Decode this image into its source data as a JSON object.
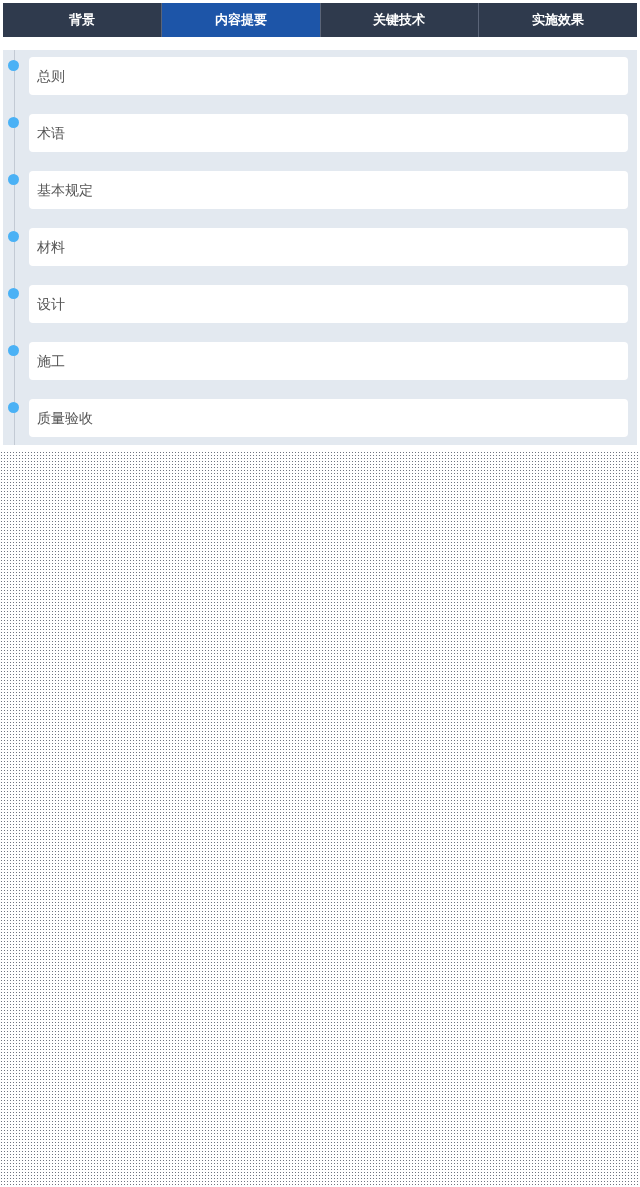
{
  "tabs": [
    {
      "label": "背景",
      "selected": false
    },
    {
      "label": "内容提要",
      "selected": true
    },
    {
      "label": "关键技术",
      "selected": false
    },
    {
      "label": "实施效果",
      "selected": false
    }
  ],
  "timeline": {
    "items": [
      {
        "label": "总则"
      },
      {
        "label": "术语"
      },
      {
        "label": "基本规定"
      },
      {
        "label": "材料"
      },
      {
        "label": "设计"
      },
      {
        "label": "施工"
      },
      {
        "label": "质量验收"
      }
    ]
  }
}
